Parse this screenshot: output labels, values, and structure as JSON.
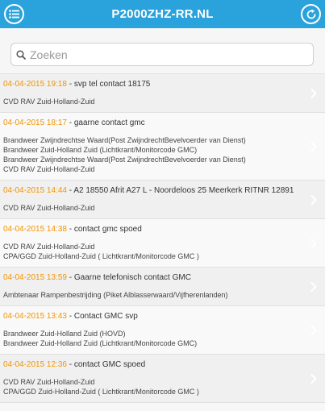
{
  "header": {
    "title": "P2000ZHZ-RR.NL"
  },
  "search": {
    "placeholder": "Zoeken",
    "value": ""
  },
  "items": [
    {
      "date": "04-04-2015 19:18",
      "text": "svp tel contact 18175",
      "units": [
        "CVD RAV Zuid-Holland-Zuid"
      ]
    },
    {
      "date": "04-04-2015 18:17",
      "text": "gaarne contact gmc",
      "units": [
        "Brandweer Zwijndrechtse Waard(Post ZwijndrechtBevelvoerder van Dienst)",
        "Brandweer Zuid-Holland Zuid (Lichtkrant/Monitorcode GMC)",
        "Brandweer Zwijndrechtse Waard(Post ZwijndrechtBevelvoerder van Dienst)",
        "CVD RAV Zuid-Holland-Zuid"
      ]
    },
    {
      "date": "04-04-2015 14:44",
      "text": "A2 18550 Afrit A27 L - Noordeloos 25 Meerkerk RITNR 12891",
      "units": [
        "CVD RAV Zuid-Holland-Zuid"
      ]
    },
    {
      "date": "04-04-2015 14:38",
      "text": "contact gmc spoed",
      "units": [
        "CVD RAV Zuid-Holland-Zuid",
        "CPA/GGD Zuid-Holland-Zuid ( Lichtkrant/Monitorcode GMC )"
      ]
    },
    {
      "date": "04-04-2015 13:59",
      "text": "Gaarne telefonisch contact GMC",
      "units": [
        "Ambtenaar Rampenbestrijding (Piket Alblasserwaard/Vijfherenlanden)"
      ]
    },
    {
      "date": "04-04-2015 13:43",
      "text": "Contact GMC svp",
      "units": [
        "Brandweer Zuid-Holland Zuid (HOVD)",
        "Brandweer Zuid-Holland Zuid (Lichtkrant/Monitorcode GMC)"
      ]
    },
    {
      "date": "04-04-2015 12:36",
      "text": "contact GMC spoed",
      "units": [
        "CVD RAV Zuid-Holland-Zuid",
        "CPA/GGD Zuid-Holland-Zuid ( Lichtkrant/Monitorcode GMC )"
      ]
    }
  ]
}
